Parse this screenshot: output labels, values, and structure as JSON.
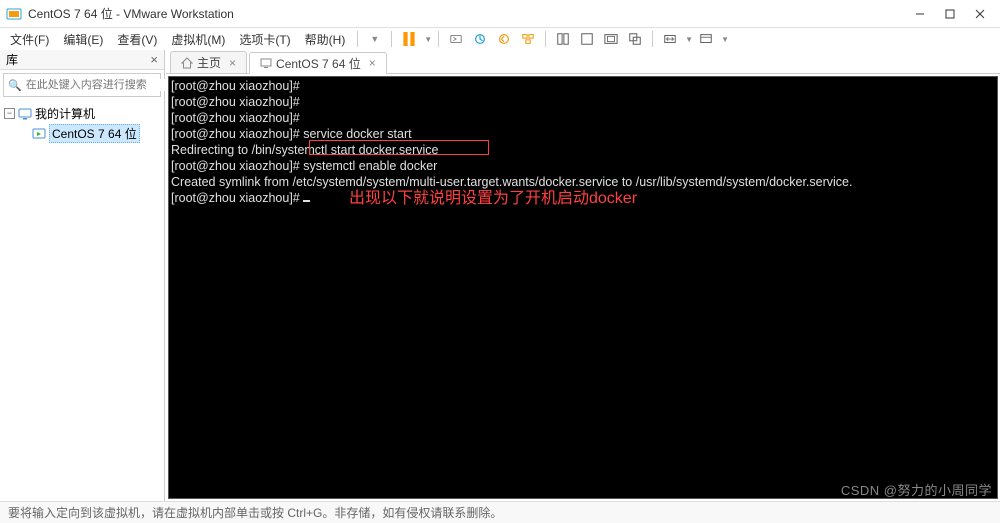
{
  "titlebar": {
    "app_name": "CentOS 7 64 位 - VMware Workstation"
  },
  "menu": {
    "file": "文件(F)",
    "edit": "编辑(E)",
    "view": "查看(V)",
    "vm": "虚拟机(M)",
    "tabs": "选项卡(T)",
    "help": "帮助(H)"
  },
  "library": {
    "title": "库",
    "search_placeholder": "在此处键入内容进行搜索",
    "root": "我的计算机",
    "child": "CentOS 7 64 位"
  },
  "tabs": {
    "home": "主页",
    "vm": "CentOS 7 64 位"
  },
  "terminal": {
    "l1": "[root@zhou xiaozhou]# ",
    "l2": "[root@zhou xiaozhou]# ",
    "l3": "[root@zhou xiaozhou]# ",
    "l4": "[root@zhou xiaozhou]# service docker start",
    "l5": "Redirecting to /bin/systemctl start docker.service",
    "l6p": "[root@zhou xiaozhou]# ",
    "l6c": "systemctl enable docker",
    "l7": "Created symlink from /etc/systemd/system/multi-user.target.wants/docker.service to /usr/lib/systemd/system/docker.service.",
    "l8": "[root@zhou xiaozhou]# ",
    "annotation": "出现以下就说明设置为了开机启动docker"
  },
  "statusbar": {
    "text": "要将输入定向到该虚拟机，请在虚拟机内部单击或按 Ctrl+G。非存储，如有侵权请联系删除。"
  },
  "watermark": "CSDN @努力的小周同学"
}
